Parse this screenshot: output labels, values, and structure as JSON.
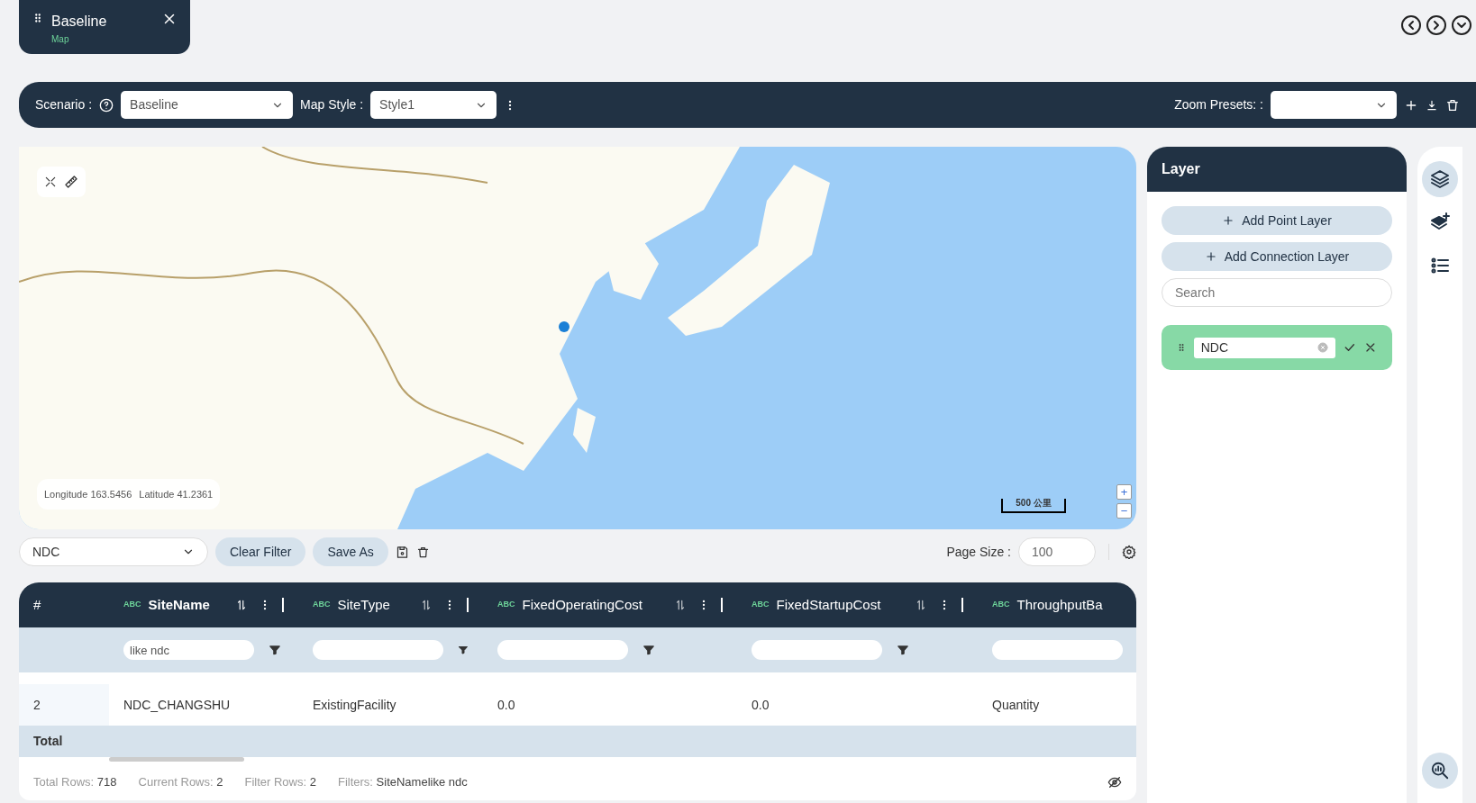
{
  "tab": {
    "title": "Baseline",
    "subtitle": "Map"
  },
  "toolbar": {
    "scenario_label": "Scenario :",
    "scenario_value": "Baseline",
    "map_style_label": "Map Style :",
    "map_style_value": "Style1",
    "zoom_presets_label": "Zoom Presets: :"
  },
  "map": {
    "coordinates": [
      {
        "label": "Longitude",
        "value": "163.5456"
      },
      {
        "label": "Latitude",
        "value": "41.2361"
      }
    ],
    "scale": "500 公里",
    "zoom_in": "+",
    "zoom_out": "−"
  },
  "filter_bar": {
    "filter_value": "NDC",
    "buttons": [
      "Clear Filter",
      "Save As"
    ],
    "page_size_label": "Page Size :",
    "page_size": "100"
  },
  "table": {
    "columns": [
      {
        "name": "#",
        "sorted": false,
        "has_filter": false
      },
      {
        "name": "SiteName",
        "type": "ABC",
        "sorted": true,
        "has_filter": true,
        "filter_value": "like ndc"
      },
      {
        "name": "SiteType",
        "type": "ABC",
        "sorted": false,
        "has_filter": true
      },
      {
        "name": "FixedOperatingCost",
        "type": "ABC",
        "sorted": false,
        "has_filter": true
      },
      {
        "name": "FixedStartupCost",
        "type": "ABC",
        "sorted": false,
        "has_filter": true
      },
      {
        "name": "ThroughputBa",
        "type": "ABC",
        "sorted": false,
        "has_filter": true
      }
    ],
    "rows": [
      [
        "2",
        "NDC_CHANGSHU",
        "ExistingFacility",
        "0.0",
        "0.0",
        "Quantity"
      ]
    ],
    "total_label": "Total",
    "footer": [
      {
        "label": "Total Rows:",
        "value": "718"
      },
      {
        "label": "Current Rows:",
        "value": "2"
      },
      {
        "label": "Filter Rows:",
        "value": "2"
      },
      {
        "label": "Filters:",
        "value": "SiteNamelike ndc"
      }
    ]
  },
  "layer_panel": {
    "title": "Layer",
    "buttons": [
      "Add Point Layer",
      "Add Connection Layer"
    ],
    "search_placeholder": "Search",
    "layers": [
      {
        "name": "NDC",
        "color": "#87d9a6"
      }
    ]
  },
  "rail": [
    {
      "kind": "layers",
      "selected": true
    },
    {
      "kind": "add-layer",
      "selected": false
    },
    {
      "kind": "legend",
      "selected": false
    }
  ]
}
